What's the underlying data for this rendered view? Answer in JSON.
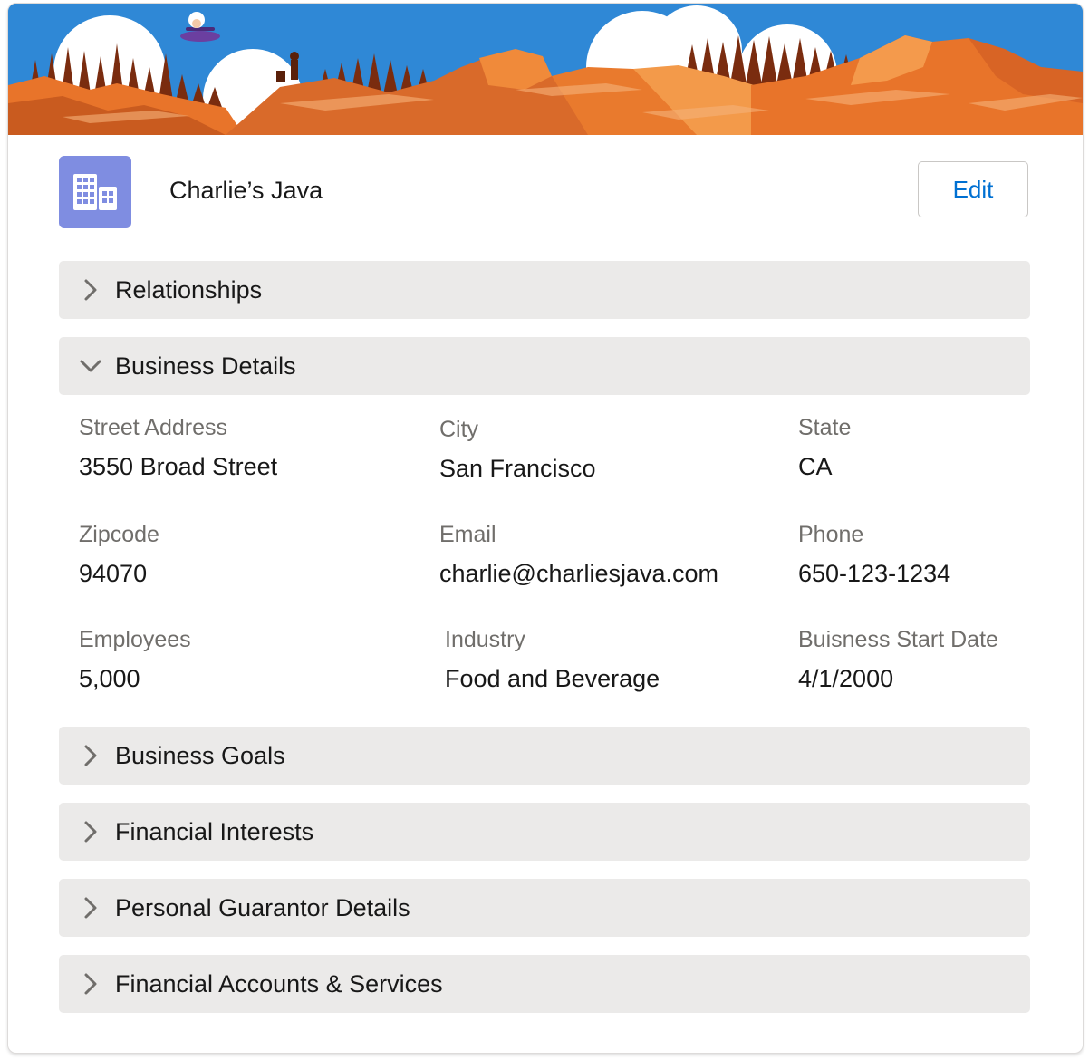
{
  "record": {
    "name": "Charlie’s Java",
    "icon": "building-icon",
    "edit_label": "Edit"
  },
  "colors": {
    "accent": "#0070d2",
    "icon_bg": "#7f8de1",
    "section_bg": "#ebeae9"
  },
  "sections": {
    "relationships": {
      "label": "Relationships",
      "expanded": false
    },
    "business_details": {
      "label": "Business Details",
      "expanded": true
    },
    "business_goals": {
      "label": "Business Goals",
      "expanded": false
    },
    "financial_interests": {
      "label": "Financial Interests",
      "expanded": false
    },
    "personal_guarantor": {
      "label": "Personal Guarantor Details",
      "expanded": false
    },
    "financial_accounts": {
      "label": "Financial Accounts & Services",
      "expanded": false
    }
  },
  "fields": {
    "street_address": {
      "label": "Street Address",
      "value": "3550 Broad Street"
    },
    "city": {
      "label": "City",
      "value": "San Francisco"
    },
    "state": {
      "label": "State",
      "value": "CA"
    },
    "zipcode": {
      "label": "Zipcode",
      "value": "94070"
    },
    "email": {
      "label": "Email",
      "value": "charlie@charliesjava.com"
    },
    "phone": {
      "label": "Phone",
      "value": "650-123-1234"
    },
    "employees": {
      "label": "Employees",
      "value": "5,000"
    },
    "industry": {
      "label": "Industry",
      "value": "Food and Beverage"
    },
    "start_date": {
      "label": "Buisness Start Date",
      "value": "4/1/2000"
    }
  }
}
